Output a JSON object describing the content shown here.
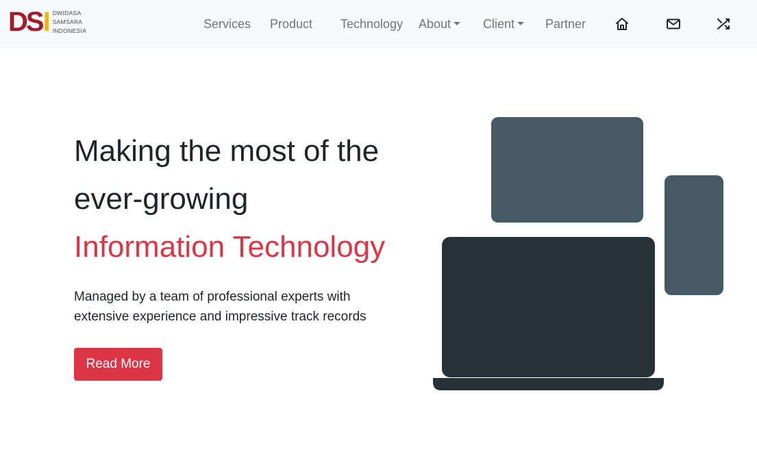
{
  "brand": {
    "letters": [
      "D",
      "S",
      "I"
    ],
    "lines": [
      "DWIDASA",
      "SAMSARA",
      "INDONESIA"
    ],
    "colors": {
      "primary": "#a01c2b",
      "secondary": "#f2b705"
    }
  },
  "nav": {
    "items": [
      {
        "label": "Services",
        "dropdown": false
      },
      {
        "label": "Product",
        "dropdown": false
      },
      {
        "label": "Technology",
        "dropdown": false
      },
      {
        "label": "About",
        "dropdown": true
      },
      {
        "label": "Client",
        "dropdown": true
      },
      {
        "label": "Partner",
        "dropdown": false
      }
    ],
    "icons": [
      "home-icon",
      "mail-icon",
      "shuffle-icon"
    ]
  },
  "hero": {
    "title_line1": "Making the most of the",
    "title_line2": "ever-growing",
    "title_accent": "Information Technology",
    "subtitle": "Managed by a team of professional experts with extensive experience and impressive track records",
    "button_label": "Read More",
    "accent_color": "#dc3545"
  },
  "illustration": {
    "name": "devices-illustration",
    "colors": {
      "light": "#455a64",
      "dark": "#263238"
    }
  }
}
